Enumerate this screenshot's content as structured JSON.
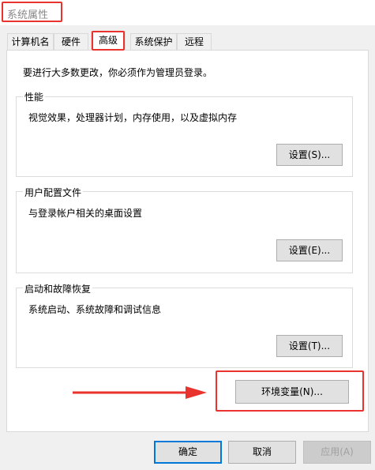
{
  "window": {
    "title": "系统属性"
  },
  "tabs": [
    {
      "label": "计算机名",
      "active": false
    },
    {
      "label": "硬件",
      "active": false
    },
    {
      "label": "高级",
      "active": true
    },
    {
      "label": "系统保护",
      "active": false
    },
    {
      "label": "远程",
      "active": false
    }
  ],
  "notice": "要进行大多数更改，你必须作为管理员登录。",
  "groups": [
    {
      "legend": "性能",
      "description": "视觉效果，处理器计划，内存使用，以及虚拟内存",
      "button": "设置(S)..."
    },
    {
      "legend": "用户配置文件",
      "description": "与登录帐户相关的桌面设置",
      "button": "设置(E)..."
    },
    {
      "legend": "启动和故障恢复",
      "description": "系统启动、系统故障和调试信息",
      "button": "设置(T)..."
    }
  ],
  "env_button": "环境变量(N)...",
  "footer": {
    "ok": "确定",
    "cancel": "取消",
    "apply": "应用(A)"
  },
  "colors": {
    "highlight": "#e8332e",
    "accent": "#0078d7",
    "dialog_bg": "#f0f0f0"
  }
}
